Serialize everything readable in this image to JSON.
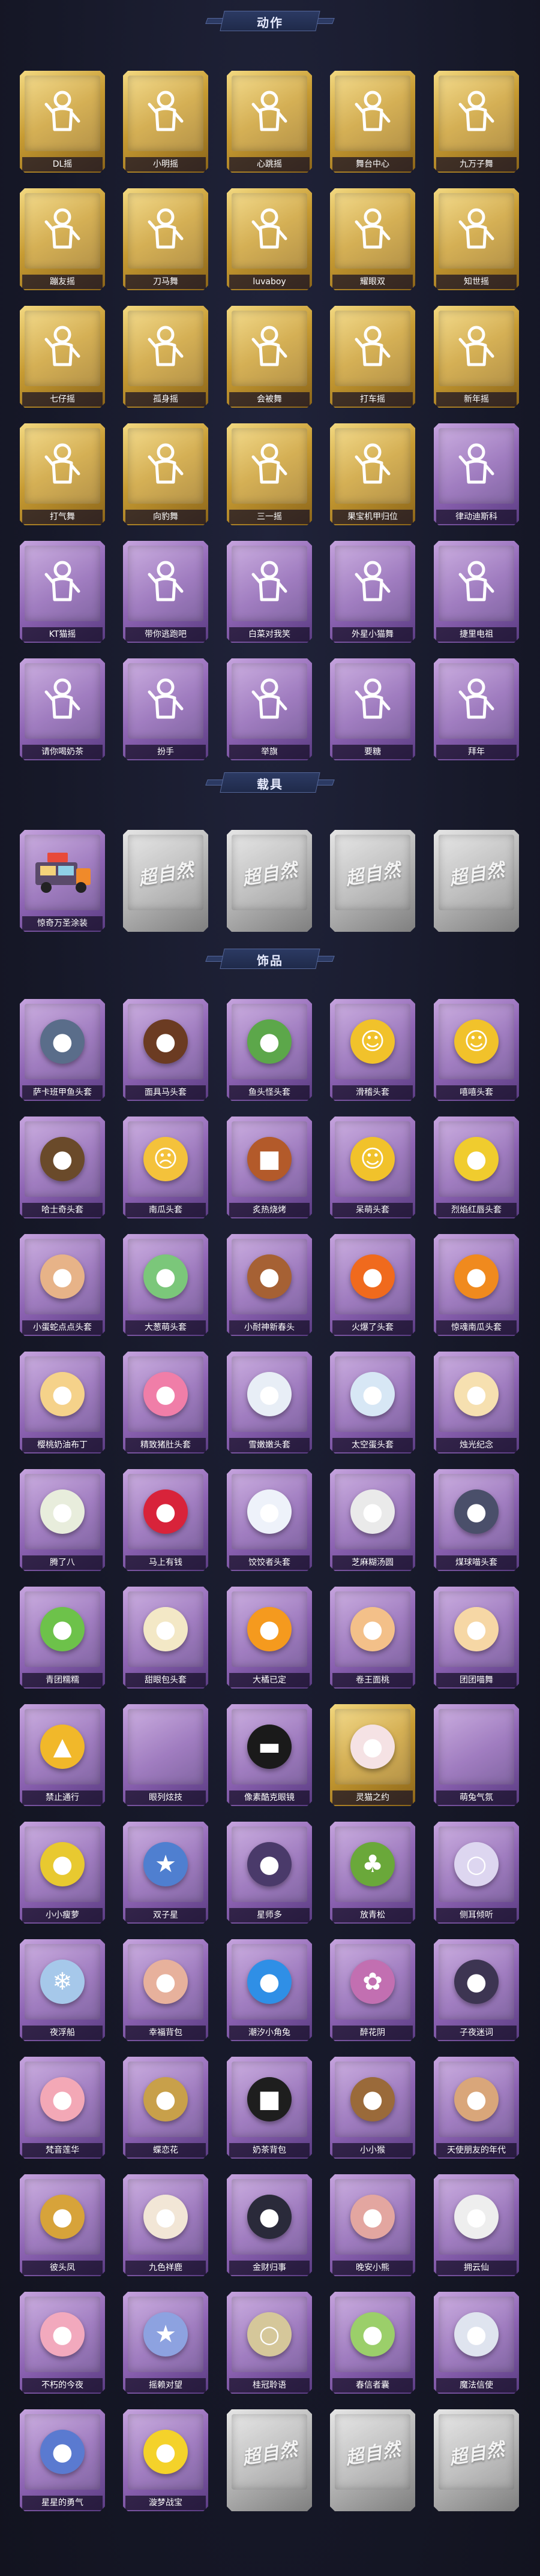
{
  "sections": [
    {
      "title": "动作",
      "items": [
        {
          "label": "DL摇",
          "rarity": "gold",
          "icon": "pose-figure-icon"
        },
        {
          "label": "小明摇",
          "rarity": "gold",
          "icon": "pose-figure-icon"
        },
        {
          "label": "心跳摇",
          "rarity": "gold",
          "icon": "pose-figure-icon"
        },
        {
          "label": "舞台中心",
          "rarity": "gold",
          "icon": "pose-figure-icon"
        },
        {
          "label": "九万子舞",
          "rarity": "gold",
          "icon": "pose-figure-icon"
        },
        {
          "label": "蹦友摇",
          "rarity": "gold",
          "icon": "pose-figure-icon"
        },
        {
          "label": "刀马舞",
          "rarity": "gold",
          "icon": "pose-figure-icon"
        },
        {
          "label": "luvaboy",
          "rarity": "gold",
          "icon": "pose-figure-icon"
        },
        {
          "label": "耀眼双",
          "rarity": "gold",
          "icon": "pose-figure-icon"
        },
        {
          "label": "知世摇",
          "rarity": "gold",
          "icon": "pose-figure-icon"
        },
        {
          "label": "七仔摇",
          "rarity": "gold",
          "icon": "pose-figure-icon"
        },
        {
          "label": "孤身摇",
          "rarity": "gold",
          "icon": "pose-figure-icon"
        },
        {
          "label": "会被舞",
          "rarity": "gold",
          "icon": "pose-figure-icon"
        },
        {
          "label": "打车摇",
          "rarity": "gold",
          "icon": "pose-figure-icon"
        },
        {
          "label": "新年摇",
          "rarity": "gold",
          "icon": "pose-figure-icon"
        },
        {
          "label": "打气舞",
          "rarity": "gold",
          "icon": "pose-figure-icon"
        },
        {
          "label": "向豹舞",
          "rarity": "gold",
          "icon": "pose-figure-icon"
        },
        {
          "label": "三一摇",
          "rarity": "gold",
          "icon": "pose-figure-icon"
        },
        {
          "label": "果宝机甲归位",
          "rarity": "gold",
          "icon": "pose-figure-icon"
        },
        {
          "label": "律动迪斯科",
          "rarity": "purple",
          "icon": "pose-figure-icon"
        },
        {
          "label": "KT猫摇",
          "rarity": "purple",
          "icon": "pose-figure-icon"
        },
        {
          "label": "带你逃跑吧",
          "rarity": "purple",
          "icon": "pose-figure-icon"
        },
        {
          "label": "白菜对我笑",
          "rarity": "purple",
          "icon": "pose-figure-icon"
        },
        {
          "label": "外星小猫舞",
          "rarity": "purple",
          "icon": "pose-figure-icon"
        },
        {
          "label": "捷里电祖",
          "rarity": "purple",
          "icon": "pose-figure-icon"
        },
        {
          "label": "请你喝奶茶",
          "rarity": "purple",
          "icon": "pose-figure-icon"
        },
        {
          "label": "扮手",
          "rarity": "purple",
          "icon": "pose-figure-icon"
        },
        {
          "label": "举旗",
          "rarity": "purple",
          "icon": "pose-figure-icon"
        },
        {
          "label": "要糖",
          "rarity": "purple",
          "icon": "pose-figure-icon"
        },
        {
          "label": "拜年",
          "rarity": "purple",
          "icon": "pose-figure-icon"
        }
      ]
    },
    {
      "title": "载具",
      "items": [
        {
          "label": "惊奇万圣涂装",
          "rarity": "purple",
          "icon": "food-truck-icon"
        },
        {
          "label": "",
          "rarity": "gray",
          "icon": "placeholder-logo-icon",
          "logo": "超自然"
        },
        {
          "label": "",
          "rarity": "gray",
          "icon": "placeholder-logo-icon",
          "logo": "超自然"
        },
        {
          "label": "",
          "rarity": "gray",
          "icon": "placeholder-logo-icon",
          "logo": "超自然"
        },
        {
          "label": "",
          "rarity": "gray",
          "icon": "placeholder-logo-icon",
          "logo": "超自然"
        }
      ]
    },
    {
      "title": "饰品",
      "items": [
        {
          "label": "萨卡班甲鱼头套",
          "rarity": "purple",
          "icon": "fish-head-icon",
          "color": "#5a6d8a",
          "glyph": "●"
        },
        {
          "label": "面具马头套",
          "rarity": "purple",
          "icon": "horse-head-icon",
          "color": "#6b3b22",
          "glyph": "●"
        },
        {
          "label": "鱼头怪头套",
          "rarity": "purple",
          "icon": "fish-monster-head-icon",
          "color": "#5ca74a",
          "glyph": "●"
        },
        {
          "label": "滑稽头套",
          "rarity": "purple",
          "icon": "smile-face-icon",
          "color": "#f1c22b",
          "glyph": "☺"
        },
        {
          "label": "嘻嘻头套",
          "rarity": "purple",
          "icon": "grin-face-icon",
          "color": "#f1c22b",
          "glyph": "☺"
        },
        {
          "label": "哈士奇头套",
          "rarity": "purple",
          "icon": "husky-head-icon",
          "color": "#6a4a2a",
          "glyph": "●"
        },
        {
          "label": "南瓜头套",
          "rarity": "purple",
          "icon": "worried-face-icon",
          "color": "#f4c23b",
          "glyph": "☹"
        },
        {
          "label": "炙热烧烤",
          "rarity": "purple",
          "icon": "bbq-block-icon",
          "color": "#b35a2a",
          "glyph": "■"
        },
        {
          "label": "呆萌头套",
          "rarity": "purple",
          "icon": "dazed-face-icon",
          "color": "#f1c22b",
          "glyph": "☺"
        },
        {
          "label": "烈焰红唇头套",
          "rarity": "purple",
          "icon": "pikachu-sunglasses-icon",
          "color": "#f0cc2e",
          "glyph": "●"
        },
        {
          "label": "小蛋蛇点点头套",
          "rarity": "purple",
          "icon": "snake-head-icon",
          "color": "#e7b388",
          "glyph": "●"
        },
        {
          "label": "大葱萌头套",
          "rarity": "purple",
          "icon": "cabbage-head-icon",
          "color": "#7bc77a",
          "glyph": "●"
        },
        {
          "label": "小耐神新春头",
          "rarity": "purple",
          "icon": "capybara-head-icon",
          "color": "#a66134",
          "glyph": "●"
        },
        {
          "label": "火爆了头套",
          "rarity": "purple",
          "icon": "flame-head-icon",
          "color": "#f06a1d",
          "glyph": "●"
        },
        {
          "label": "惊魂南瓜头套",
          "rarity": "purple",
          "icon": "pumpkin-head-icon",
          "color": "#f08a1e",
          "glyph": "●"
        },
        {
          "label": "樱桃奶油布丁",
          "rarity": "purple",
          "icon": "pudding-icon",
          "color": "#f5d28a",
          "glyph": "●"
        },
        {
          "label": "精致猪肚头套",
          "rarity": "purple",
          "icon": "pig-head-icon",
          "color": "#f07ea8",
          "glyph": "●"
        },
        {
          "label": "雪嫩嫩头套",
          "rarity": "purple",
          "icon": "snowman-head-icon",
          "color": "#e8eef6",
          "glyph": "●"
        },
        {
          "label": "太空蛋头套",
          "rarity": "purple",
          "icon": "space-egg-icon",
          "color": "#d7e7f5",
          "glyph": "●"
        },
        {
          "label": "烛光纪念",
          "rarity": "purple",
          "icon": "candle-icon",
          "color": "#f6e0b0",
          "glyph": "●"
        },
        {
          "label": "腾了八",
          "rarity": "purple",
          "icon": "radish-head-icon",
          "color": "#e8eddc",
          "glyph": "●"
        },
        {
          "label": "马上有钱",
          "rarity": "purple",
          "icon": "money-head-icon",
          "color": "#d8233a",
          "glyph": "●"
        },
        {
          "label": "饺饺者头套",
          "rarity": "purple",
          "icon": "dumpling-head-icon",
          "color": "#eef2fa",
          "glyph": "●"
        },
        {
          "label": "芝麻糊汤圆",
          "rarity": "purple",
          "icon": "tangyuan-icon",
          "color": "#eaeaea",
          "glyph": "●"
        },
        {
          "label": "煤球喵头套",
          "rarity": "purple",
          "icon": "cat-head-icon",
          "color": "#4a4f6a",
          "glyph": "●"
        },
        {
          "label": "青团糯糯",
          "rarity": "purple",
          "icon": "green-bun-icon",
          "color": "#6dc24a",
          "glyph": "●"
        },
        {
          "label": "甜眼包头套",
          "rarity": "purple",
          "icon": "bun-head-icon",
          "color": "#f3e8c6",
          "glyph": "●"
        },
        {
          "label": "大橘已定",
          "rarity": "purple",
          "icon": "orange-slice-icon",
          "color": "#f59a1e",
          "glyph": "●"
        },
        {
          "label": "卷王面桃",
          "rarity": "purple",
          "icon": "roll-cake-icon",
          "color": "#f3c089",
          "glyph": "●"
        },
        {
          "label": "团团喵舞",
          "rarity": "purple",
          "icon": "cat-bun-icon",
          "color": "#f6d7a5",
          "glyph": "●"
        },
        {
          "label": "禁止通行",
          "rarity": "purple",
          "icon": "traffic-cone-icon",
          "color": "#f1b82a",
          "glyph": "▲"
        },
        {
          "label": "眼列炫技",
          "rarity": "purple",
          "icon": "blank-item-icon",
          "color": "#b99ad6",
          "glyph": ""
        },
        {
          "label": "像素酷克眼镜",
          "rarity": "purple",
          "icon": "pixel-sunglasses-icon",
          "color": "#1a1a1a",
          "glyph": "▬"
        },
        {
          "label": "灵猫之约",
          "rarity": "gold",
          "icon": "cat-ears-icon",
          "color": "#f5e2e4",
          "glyph": "●"
        },
        {
          "label": "萌兔气氛",
          "rarity": "purple",
          "icon": "blank-item-icon",
          "color": "#b99ad6",
          "glyph": ""
        },
        {
          "label": "小小瘦萝",
          "rarity": "purple",
          "icon": "lemon-figure-icon",
          "color": "#e8c930",
          "glyph": "●"
        },
        {
          "label": "双子星",
          "rarity": "purple",
          "icon": "twin-star-icon",
          "color": "#4f7fd0",
          "glyph": "★"
        },
        {
          "label": "星师多",
          "rarity": "purple",
          "icon": "chibi-girl-icon",
          "color": "#4a3a6a",
          "glyph": "●"
        },
        {
          "label": "放青松",
          "rarity": "purple",
          "icon": "pine-tree-icon",
          "color": "#6aa83a",
          "glyph": "♣"
        },
        {
          "label": "侧耳倾听",
          "rarity": "purple",
          "icon": "pearl-ring-icon",
          "color": "#ddd6f0",
          "glyph": "○"
        },
        {
          "label": "夜浮船",
          "rarity": "purple",
          "icon": "ice-crystal-icon",
          "color": "#a6c8ea",
          "glyph": "❄"
        },
        {
          "label": "幸福背包",
          "rarity": "purple",
          "icon": "backpack-icon",
          "color": "#e7b19c",
          "glyph": "●"
        },
        {
          "label": "潮汐小角兔",
          "rarity": "purple",
          "icon": "blue-monster-icon",
          "color": "#2f8fe6",
          "glyph": "●"
        },
        {
          "label": "醉花阴",
          "rarity": "purple",
          "icon": "flower-fairy-icon",
          "color": "#c26fb1",
          "glyph": "✿"
        },
        {
          "label": "子夜迷词",
          "rarity": "purple",
          "icon": "dark-fairy-icon",
          "color": "#3d3552",
          "glyph": "●"
        },
        {
          "label": "梵音莲华",
          "rarity": "purple",
          "icon": "lotus-girl-icon",
          "color": "#f3a8b6",
          "glyph": "●"
        },
        {
          "label": "蝶恋花",
          "rarity": "purple",
          "icon": "butterfly-pendant-icon",
          "color": "#c8a04a",
          "glyph": "●"
        },
        {
          "label": "奶茶背包",
          "rarity": "purple",
          "icon": "milk-tea-bag-icon",
          "color": "#1e1e1e",
          "glyph": "■"
        },
        {
          "label": "小小猴",
          "rarity": "purple",
          "icon": "monkey-icon",
          "color": "#9a6a3a",
          "glyph": "●"
        },
        {
          "label": "天使朋友的年代",
          "rarity": "purple",
          "icon": "doll-girl-icon",
          "color": "#d9a67a",
          "glyph": "●"
        },
        {
          "label": "彼头凤",
          "rarity": "purple",
          "icon": "phoenix-doll-icon",
          "color": "#d7a33a",
          "glyph": "●"
        },
        {
          "label": "九色祥鹿",
          "rarity": "purple",
          "icon": "deer-pendant-icon",
          "color": "#f2e6d6",
          "glyph": "●"
        },
        {
          "label": "金财归事",
          "rarity": "purple",
          "icon": "chibi-boy-icon",
          "color": "#2a2a3a",
          "glyph": "●"
        },
        {
          "label": "晚安小熊",
          "rarity": "purple",
          "icon": "bear-pendant-icon",
          "color": "#e3a6a0",
          "glyph": "●"
        },
        {
          "label": "拥云仙",
          "rarity": "purple",
          "icon": "bunny-pendant-icon",
          "color": "#eeeeee",
          "glyph": "●"
        },
        {
          "label": "不朽的今夜",
          "rarity": "purple",
          "icon": "pink-bunny-icon",
          "color": "#f2a9bd",
          "glyph": "●"
        },
        {
          "label": "摇赖对望",
          "rarity": "purple",
          "icon": "star-pendant-icon",
          "color": "#8da2e0",
          "glyph": "★"
        },
        {
          "label": "桂冠聆语",
          "rarity": "purple",
          "icon": "wreath-icon",
          "color": "#d5c79a",
          "glyph": "○"
        },
        {
          "label": "春信者囊",
          "rarity": "purple",
          "icon": "sprout-pendant-icon",
          "color": "#9bcf6a",
          "glyph": "●"
        },
        {
          "label": "魔法信使",
          "rarity": "purple",
          "icon": "mouse-pendant-icon",
          "color": "#dfe4ef",
          "glyph": "●"
        },
        {
          "label": "星星的勇气",
          "rarity": "purple",
          "icon": "doll-pendant-icon",
          "color": "#5a7ad0",
          "glyph": "●"
        },
        {
          "label": "漩梦战宝",
          "rarity": "purple",
          "icon": "yellow-bird-icon",
          "color": "#f4d22a",
          "glyph": "●"
        },
        {
          "label": "",
          "rarity": "gray",
          "icon": "placeholder-logo-icon",
          "logo": "超自然"
        },
        {
          "label": "",
          "rarity": "gray",
          "icon": "placeholder-logo-icon",
          "logo": "超自然"
        },
        {
          "label": "",
          "rarity": "gray",
          "icon": "placeholder-logo-icon",
          "logo": "超自然"
        }
      ]
    }
  ],
  "colors": {
    "gold": "#d8b04a",
    "purple": "#9b74c4",
    "gray": "#b9b9b9",
    "background": "#17192a"
  }
}
